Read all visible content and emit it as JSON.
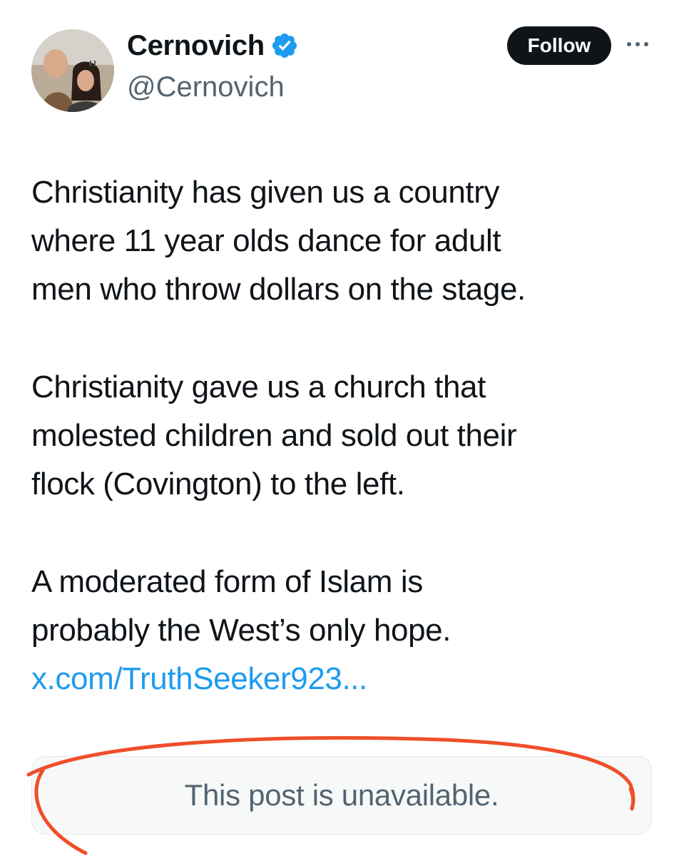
{
  "header": {
    "display_name": "Cernovich",
    "handle": "@Cernovich",
    "follow_label": "Follow"
  },
  "icons": {
    "avatar": "profile-photo",
    "verified": "verified-badge-icon",
    "more": "more-options-icon"
  },
  "tweet": {
    "paragraphs": [
      "Christianity has given us a country\nwhere 11 year olds dance for adult\nmen who throw dollars on the stage.",
      "Christianity gave us a church that\nmolested children and sold out their\nflock (Covington) to the left.",
      "A moderated form of Islam is\nprobably the West’s only hope."
    ],
    "link": "x.com/TruthSeeker923..."
  },
  "quote": {
    "text": "This post is unavailable."
  },
  "colors": {
    "text": "#0f1419",
    "secondary": "#536471",
    "link": "#1d9bf0",
    "verified": "#1d9bf0",
    "annotation": "#f04e2a"
  }
}
